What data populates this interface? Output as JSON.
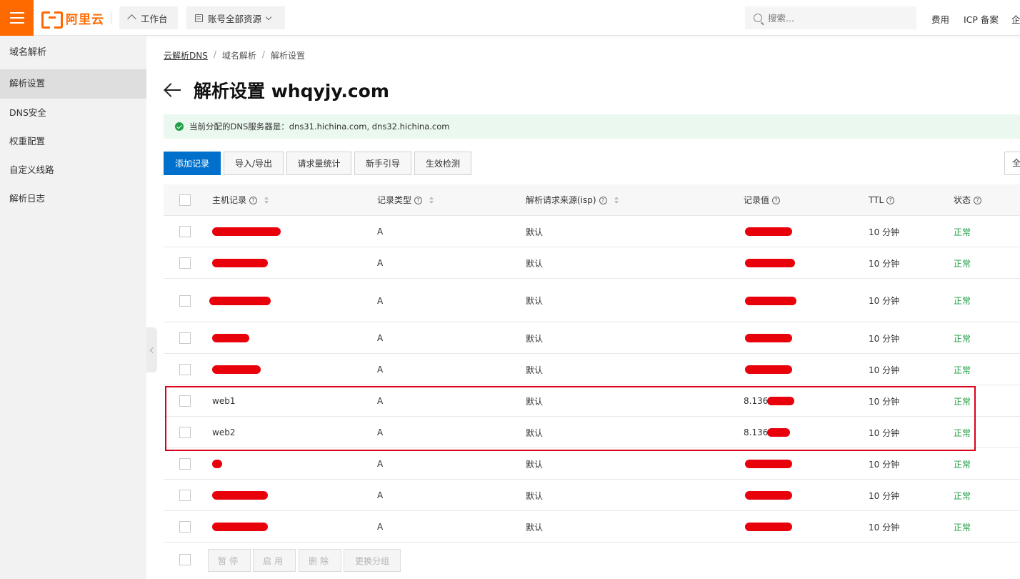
{
  "topbar": {
    "brand": "阿里云",
    "workbench": "工作台",
    "resources": "账号全部资源",
    "search_placeholder": "搜索...",
    "links": [
      "费用",
      "ICP 备案",
      "企"
    ]
  },
  "sidebar": {
    "title": "域名解析",
    "items": [
      {
        "label": "解析设置",
        "active": true
      },
      {
        "label": "DNS安全"
      },
      {
        "label": "权重配置"
      },
      {
        "label": "自定义线路"
      },
      {
        "label": "解析日志"
      }
    ]
  },
  "breadcrumb": [
    "云解析DNS",
    "域名解析",
    "解析设置"
  ],
  "page_title": "解析设置 whqyjy.com",
  "notice": "当前分配的DNS服务器是：dns31.hichina.com, dns32.hichina.com",
  "toolbar": {
    "add": "添加记录",
    "import_export": "导入/导出",
    "stats": "请求量统计",
    "guide": "新手引导",
    "check": "生效检测",
    "edge": "全"
  },
  "table": {
    "headers": {
      "host": "主机记录",
      "type": "记录类型",
      "isp": "解析请求来源(isp)",
      "value": "记录值",
      "ttl": "TTL",
      "status": "状态"
    },
    "rows": [
      {
        "host": "",
        "type": "A",
        "isp": "默认",
        "value": "",
        "ttl": "10 分钟",
        "status": "正常"
      },
      {
        "host": "",
        "type": "A",
        "isp": "默认",
        "value": "",
        "ttl": "10 分钟",
        "status": "正常"
      },
      {
        "host": "",
        "type": "A",
        "isp": "默认",
        "value": "",
        "ttl": "10 分钟",
        "status": "正常"
      },
      {
        "host": "",
        "type": "A",
        "isp": "默认",
        "value": "",
        "ttl": "10 分钟",
        "status": "正常"
      },
      {
        "host": "",
        "type": "A",
        "isp": "默认",
        "value": "",
        "ttl": "10 分钟",
        "status": "正常"
      },
      {
        "host": "web1",
        "type": "A",
        "isp": "默认",
        "value": "8.136.",
        "ttl": "10 分钟",
        "status": "正常"
      },
      {
        "host": "web2",
        "type": "A",
        "isp": "默认",
        "value": "8.136.",
        "ttl": "10 分钟",
        "status": "正常"
      },
      {
        "host": "",
        "type": "A",
        "isp": "默认",
        "value": "",
        "ttl": "10 分钟",
        "status": "正常"
      },
      {
        "host": "",
        "type": "A",
        "isp": "默认",
        "value": "",
        "ttl": "10 分钟",
        "status": "正常"
      },
      {
        "host": "",
        "type": "A",
        "isp": "默认",
        "value": "",
        "ttl": "10 分钟",
        "status": "正常"
      }
    ]
  },
  "bulk_actions": {
    "pause": "暂停",
    "enable": "启用",
    "delete": "删除",
    "change_group": "更换分组"
  },
  "colors": {
    "brand": "#ff6a00",
    "primary": "#0070cc",
    "success": "#1f9f46",
    "annotation": "#d9001b"
  }
}
